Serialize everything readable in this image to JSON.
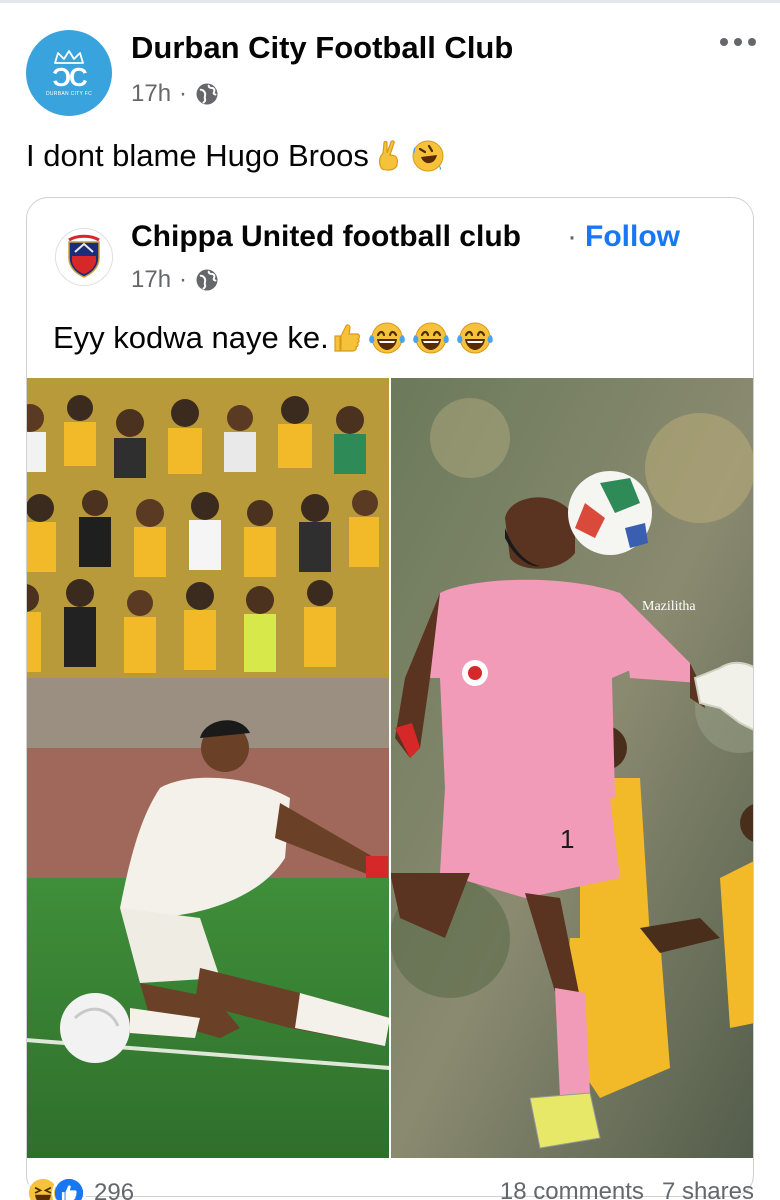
{
  "post": {
    "author": "Durban City Football Club",
    "avatar_text": "DURBAN CITY FC",
    "time": "17h",
    "separator": "·",
    "caption": "I dont blame Hugo Broos",
    "caption_emojis": [
      "crossed-fingers-emoji",
      "rolling-laughing-emoji"
    ]
  },
  "shared": {
    "author": "Chippa United football club",
    "separator": "·",
    "follow_label": "Follow",
    "time": "17h",
    "caption": "Eyy kodwa naye ke.",
    "caption_emojis": [
      "thumbs-up-emoji",
      "tears-of-joy-emoji",
      "tears-of-joy-emoji",
      "tears-of-joy-emoji"
    ],
    "photo_watermark": "Mazilitha"
  },
  "footer": {
    "reaction_count": "296",
    "comments": "18 comments",
    "shares": "7 shares",
    "reaction_icons": [
      "laugh-reaction-icon",
      "like-reaction-icon"
    ]
  },
  "colors": {
    "link_blue": "#1877f2",
    "secondary_text": "#65676b",
    "avatar_blue": "#38a3dc",
    "keeper_pink": "#f29bb8",
    "kit_yellow": "#f2b928"
  }
}
